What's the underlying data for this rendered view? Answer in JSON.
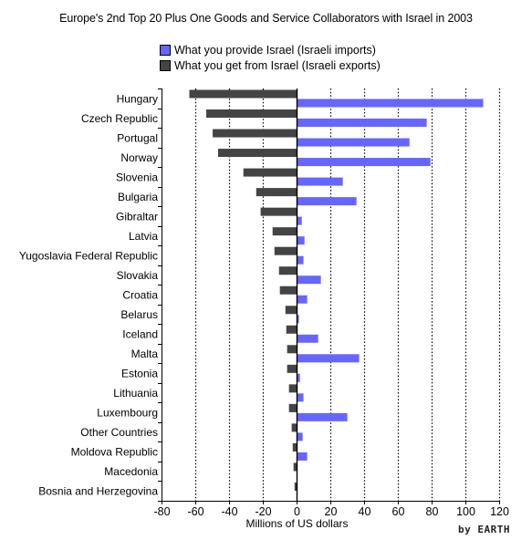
{
  "chart_data": {
    "type": "bar",
    "orientation": "horizontal",
    "title": "Europe's 2nd Top 20 Plus One Goods and Service Collaborators with Israel in 2003",
    "xlabel": "Millions of US dollars",
    "ylabel": "",
    "xlim": [
      -80,
      120
    ],
    "xticks": [
      -80,
      -60,
      -40,
      -20,
      0,
      20,
      40,
      60,
      80,
      100,
      120
    ],
    "grid": "vertical dotted",
    "legend_placement": "top-center",
    "categories": [
      "Hungary",
      "Czech Republic",
      "Portugal",
      "Norway",
      "Slovenia",
      "Bulgaria",
      "Gibraltar",
      "Latvia",
      "Yugoslavia Federal Republic",
      "Slovakia",
      "Croatia",
      "Belarus",
      "Iceland",
      "Malta",
      "Estonia",
      "Lithuania",
      "Luxembourg",
      "Other Countries",
      "Moldova Republic",
      "Macedonia",
      "Bosnia and Herzegovina"
    ],
    "series": [
      {
        "name": "What you get from Israel (Israeli exports)",
        "color": "#444444",
        "values": [
          -63.5,
          -53.5,
          -49.7,
          -46.5,
          -31.5,
          -23.9,
          -21.3,
          -14.2,
          -13.1,
          -10.4,
          -9.9,
          -6.6,
          -6.1,
          -5.6,
          -5.6,
          -4.5,
          -4.5,
          -2.9,
          -2.3,
          -1.8,
          -1.2
        ]
      },
      {
        "name": "What you provide Israel (Israeli imports)",
        "color": "#6666ff",
        "values": [
          110.6,
          77.1,
          66.9,
          79.3,
          27.4,
          35.5,
          3.1,
          4.7,
          4.1,
          14.4,
          6.3,
          1.4,
          12.8,
          37.1,
          2.0,
          4.1,
          30.1,
          3.6,
          6.3,
          0.4,
          0.4
        ]
      }
    ],
    "credit": "by EARTH"
  },
  "legend": {
    "items": [
      {
        "label": "What you provide Israel (Israeli imports)",
        "color": "#6666ff"
      },
      {
        "label": "What you get from Israel (Israeli exports)",
        "color": "#444444"
      }
    ]
  }
}
